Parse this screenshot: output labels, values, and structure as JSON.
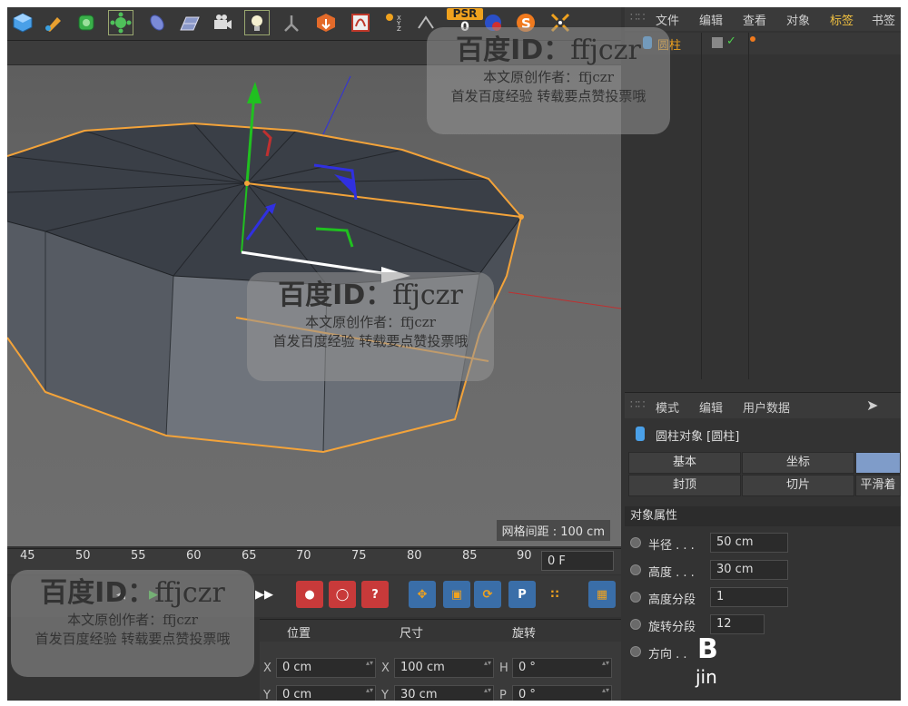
{
  "toolbar": {
    "psr_label": "PSR",
    "psr_value": "0"
  },
  "viewport": {
    "grid_spacing": "网格间距 : 100 cm"
  },
  "timeline": {
    "ticks": [
      "45",
      "50",
      "55",
      "60",
      "65",
      "70",
      "75",
      "80",
      "85",
      "90"
    ],
    "frame_field": "0 F"
  },
  "coords": {
    "headers": {
      "position": "位置",
      "size": "尺寸",
      "rotation": "旋转"
    },
    "rows": [
      {
        "pos_axis": "X",
        "pos": "0 cm",
        "size_axis": "X",
        "size": "100 cm",
        "rot_axis": "H",
        "rot": "0 °"
      },
      {
        "pos_axis": "Y",
        "pos": "0 cm",
        "size_axis": "Y",
        "size": "30 cm",
        "rot_axis": "P",
        "rot": "0 °"
      }
    ]
  },
  "object_manager": {
    "menu": [
      "文件",
      "编辑",
      "查看",
      "对象",
      "标签",
      "书签"
    ],
    "active_menu": "标签",
    "object_name": "圆柱"
  },
  "attributes": {
    "menu": [
      "模式",
      "编辑",
      "用户数据"
    ],
    "title": "圆柱对象 [圆柱]",
    "tabs_row1": [
      "基本",
      "坐标",
      ""
    ],
    "tabs_row2": [
      "封顶",
      "切片",
      "平滑着"
    ],
    "section": "对象属性",
    "props": [
      {
        "label": "半径 . . .",
        "value": "50 cm"
      },
      {
        "label": "高度 . . .",
        "value": "30 cm"
      },
      {
        "label": "高度分段",
        "value": "1"
      },
      {
        "label": "旋转分段",
        "value": "12"
      },
      {
        "label": "方向 . .",
        "value": ""
      }
    ]
  },
  "watermarks": [
    {
      "id_label": "百度ID：",
      "id": "ffjczr",
      "line1": "本文原创作者：ffjczr",
      "line2": "首发百度经验  转载要点赞投票哦"
    }
  ],
  "corner_logo": {
    "text1": "B",
    "text2": "jin"
  },
  "colors": {
    "accent_orange": "#f0a21e",
    "selection_orange": "#f3a33a",
    "axis_green": "#20c020",
    "axis_blue": "#3030e0",
    "axis_red": "#c03030",
    "tab_blue": "#7f9cc9"
  }
}
